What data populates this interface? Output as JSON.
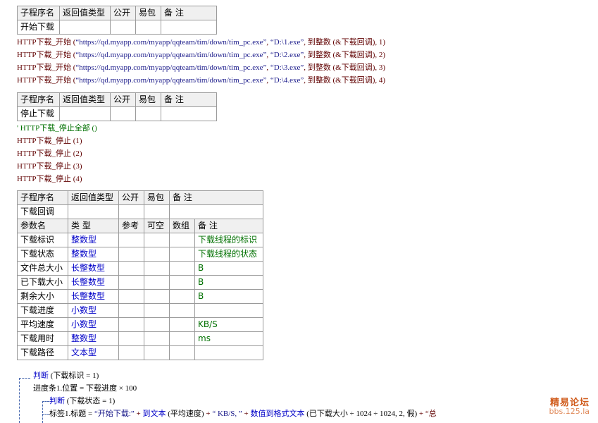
{
  "headers": {
    "sub": "子程序名",
    "ret": "返回值类型",
    "pub": "公开",
    "easy": "易包",
    "note": "备 注",
    "param": "参数名",
    "type": "类 型",
    "ref": "参考",
    "opt": "可空",
    "arr": "数组"
  },
  "sub1": {
    "name": "开始下载"
  },
  "code1": [
    {
      "fn": "HTTP下载_开始",
      "url": "“https://qd.myapp.com/myapp/qqteam/tim/down/tim_pc.exe”",
      "path": "“D:\\1.exe”",
      "int": "到整数",
      "cb": "(&下载回调)",
      "idx": "1)"
    },
    {
      "fn": "HTTP下载_开始",
      "url": "“https://qd.myapp.com/myapp/qqteam/tim/down/tim_pc.exe”",
      "path": "“D:\\2.exe”",
      "int": "到整数",
      "cb": "(&下载回调)",
      "idx": "2)"
    },
    {
      "fn": "HTTP下载_开始",
      "url": "“https://qd.myapp.com/myapp/qqteam/tim/down/tim_pc.exe”",
      "path": "“D:\\3.exe”",
      "int": "到整数",
      "cb": "(&下载回调)",
      "idx": "3)"
    },
    {
      "fn": "HTTP下载_开始",
      "url": "“https://qd.myapp.com/myapp/qqteam/tim/down/tim_pc.exe”",
      "path": "“D:\\4.exe”",
      "int": "到整数",
      "cb": "(&下载回调)",
      "idx": "4)"
    }
  ],
  "sub2": {
    "name": "停止下载"
  },
  "code2": {
    "comment": "' HTTP下载_停止全部 ()",
    "lines": [
      "HTTP下载_停止 (1)",
      "HTTP下载_停止 (2)",
      "HTTP下载_停止 (3)",
      "HTTP下载_停止 (4)"
    ]
  },
  "sub3": {
    "name": "下载回调"
  },
  "params": [
    {
      "name": "下载标识",
      "type": "整数型",
      "note": "下载线程的标识"
    },
    {
      "name": "下载状态",
      "type": "整数型",
      "note": "下载线程的状态"
    },
    {
      "name": "文件总大小",
      "type": "长整数型",
      "note": "B"
    },
    {
      "name": "已下载大小",
      "type": "长整数型",
      "note": "B"
    },
    {
      "name": "剩余大小",
      "type": "长整数型",
      "note": "B"
    },
    {
      "name": "下载进度",
      "type": "小数型",
      "note": ""
    },
    {
      "name": "平均速度",
      "type": "小数型",
      "note": "KB/S"
    },
    {
      "name": "下载用时",
      "type": "整数型",
      "note": "ms"
    },
    {
      "name": "下载路径",
      "type": "文本型",
      "note": ""
    }
  ],
  "code3": {
    "if1_kw": "判断",
    "if1_cond": "(下载标识 = 1)",
    "assign": "进度条1.位置 = 下载进度 × 100",
    "if2_kw": "判断",
    "if2_cond": "(下载状态 = 1)",
    "label_lhs": "标签1.标题 =",
    "s1": "“开始下载:”",
    "plus": "+",
    "fn_text": "到文本",
    "arg_speed": "(平均速度)",
    "s2": "“ KB/S, ”",
    "fn_fmt": "数值到格式文本",
    "fmt_args": "(已下载大小 ÷ 1024 ÷ 1024, 2, 假)",
    "tail": "+ “总"
  },
  "watermark": {
    "line1": "精易论坛",
    "line2": "bbs.125.la"
  }
}
